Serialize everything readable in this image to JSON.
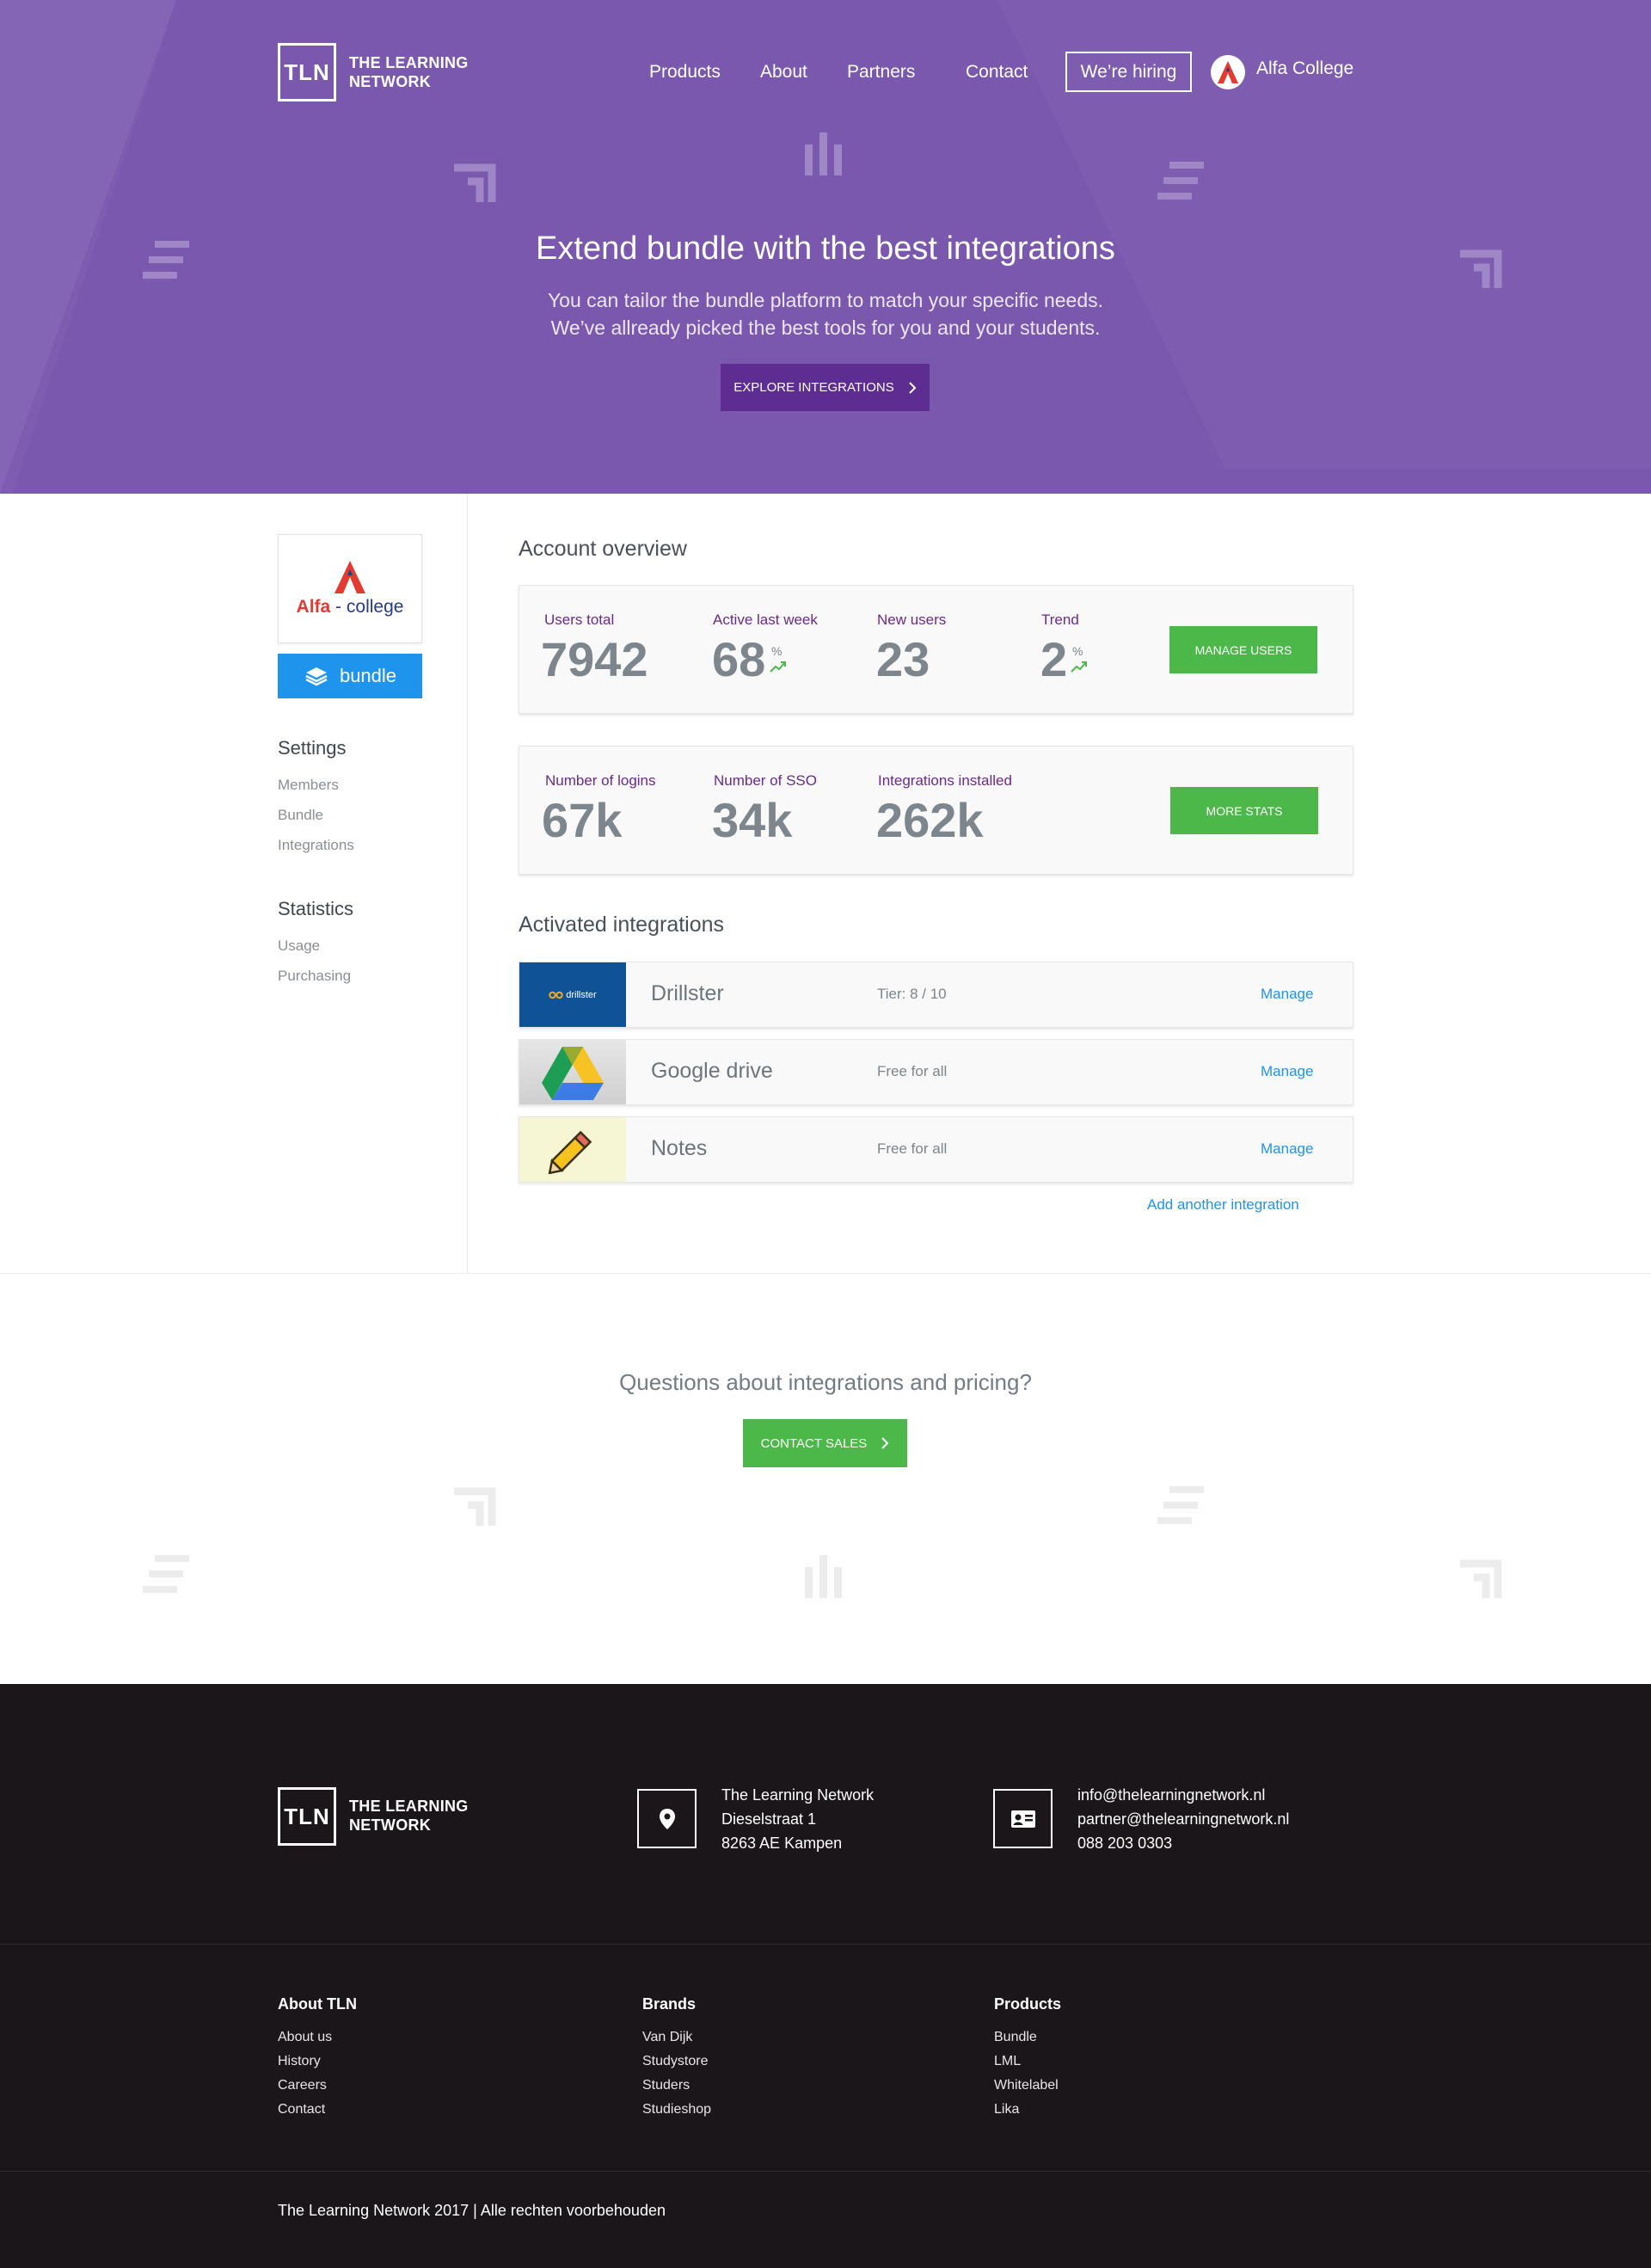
{
  "brand": {
    "logo_mark": "TLN",
    "logo_line1": "THE LEARNING",
    "logo_line2": "NETWORK"
  },
  "nav": {
    "items": [
      "Products",
      "About",
      "Partners",
      "Contact"
    ],
    "hiring_label": "We’re hiring",
    "school_name": "Alfa College"
  },
  "hero": {
    "title": "Extend bundle with the best integrations",
    "subtitle_line1": "You can tailor the bundle platform to match your specific needs.",
    "subtitle_line2": "We’ve allready picked the best tools for you and your students.",
    "cta_label": "EXPLORE INTEGRATIONS"
  },
  "sidebar": {
    "school_logo": {
      "word1": "Alfa",
      "separator": " - ",
      "word2": "college"
    },
    "bundle_label": "bundle",
    "settings_title": "Settings",
    "settings_items": [
      "Members",
      "Bundle",
      "Integrations"
    ],
    "statistics_title": "Statistics",
    "statistics_items": [
      "Usage",
      "Purchasing"
    ]
  },
  "overview": {
    "title": "Account overview",
    "card1": {
      "users_total_label": "Users total",
      "users_total_value": "7942",
      "active_label": "Active last week",
      "active_value": "68",
      "active_unit": "%",
      "new_label": "New users",
      "new_value": "23",
      "trend_label": "Trend",
      "trend_value": "2",
      "trend_unit": "%",
      "button_label": "MANAGE USERS"
    },
    "card2": {
      "logins_label": "Number of logins",
      "logins_value": "67k",
      "sso_label": "Number of SSO",
      "sso_value": "34k",
      "installed_label": "Integrations installed",
      "installed_value": "262k",
      "button_label": "MORE STATS"
    }
  },
  "integrations": {
    "title": "Activated integrations",
    "rows": [
      {
        "name": "Drillster",
        "tier": "Tier:  8 / 10",
        "manage": "Manage",
        "thumb_text": "drillster"
      },
      {
        "name": "Google drive",
        "tier": "Free for all",
        "manage": "Manage"
      },
      {
        "name": "Notes",
        "tier": "Free for all",
        "manage": "Manage"
      }
    ],
    "add_label": "Add another integration"
  },
  "cta": {
    "title": "Questions about integrations and pricing?",
    "button_label": "CONTACT SALES"
  },
  "footer": {
    "address": [
      "The Learning Network",
      "Dieselstraat 1",
      "8263 AE Kampen"
    ],
    "contact": [
      "info@thelearningnetwork.nl",
      "partner@thelearningnetwork.nl",
      "088 203 0303"
    ],
    "columns": [
      {
        "title": "About TLN",
        "links": [
          "About us",
          "History",
          "Careers",
          "Contact"
        ]
      },
      {
        "title": "Brands",
        "links": [
          "Van Dijk",
          "Studystore",
          "Studers",
          "Studieshop"
        ]
      },
      {
        "title": "Products",
        "links": [
          "Bundle",
          "LML",
          "Whitelabel",
          "Lika"
        ]
      }
    ],
    "copyright": "The Learning Network 2017 | Alle rechten voorbehouden"
  },
  "colors": {
    "hero_purple": "#7e5db1",
    "button_purple": "#5e2d91",
    "accent_blue": "#1e94ec",
    "accent_green": "#4db84a",
    "footer_dark": "#1b1619"
  }
}
